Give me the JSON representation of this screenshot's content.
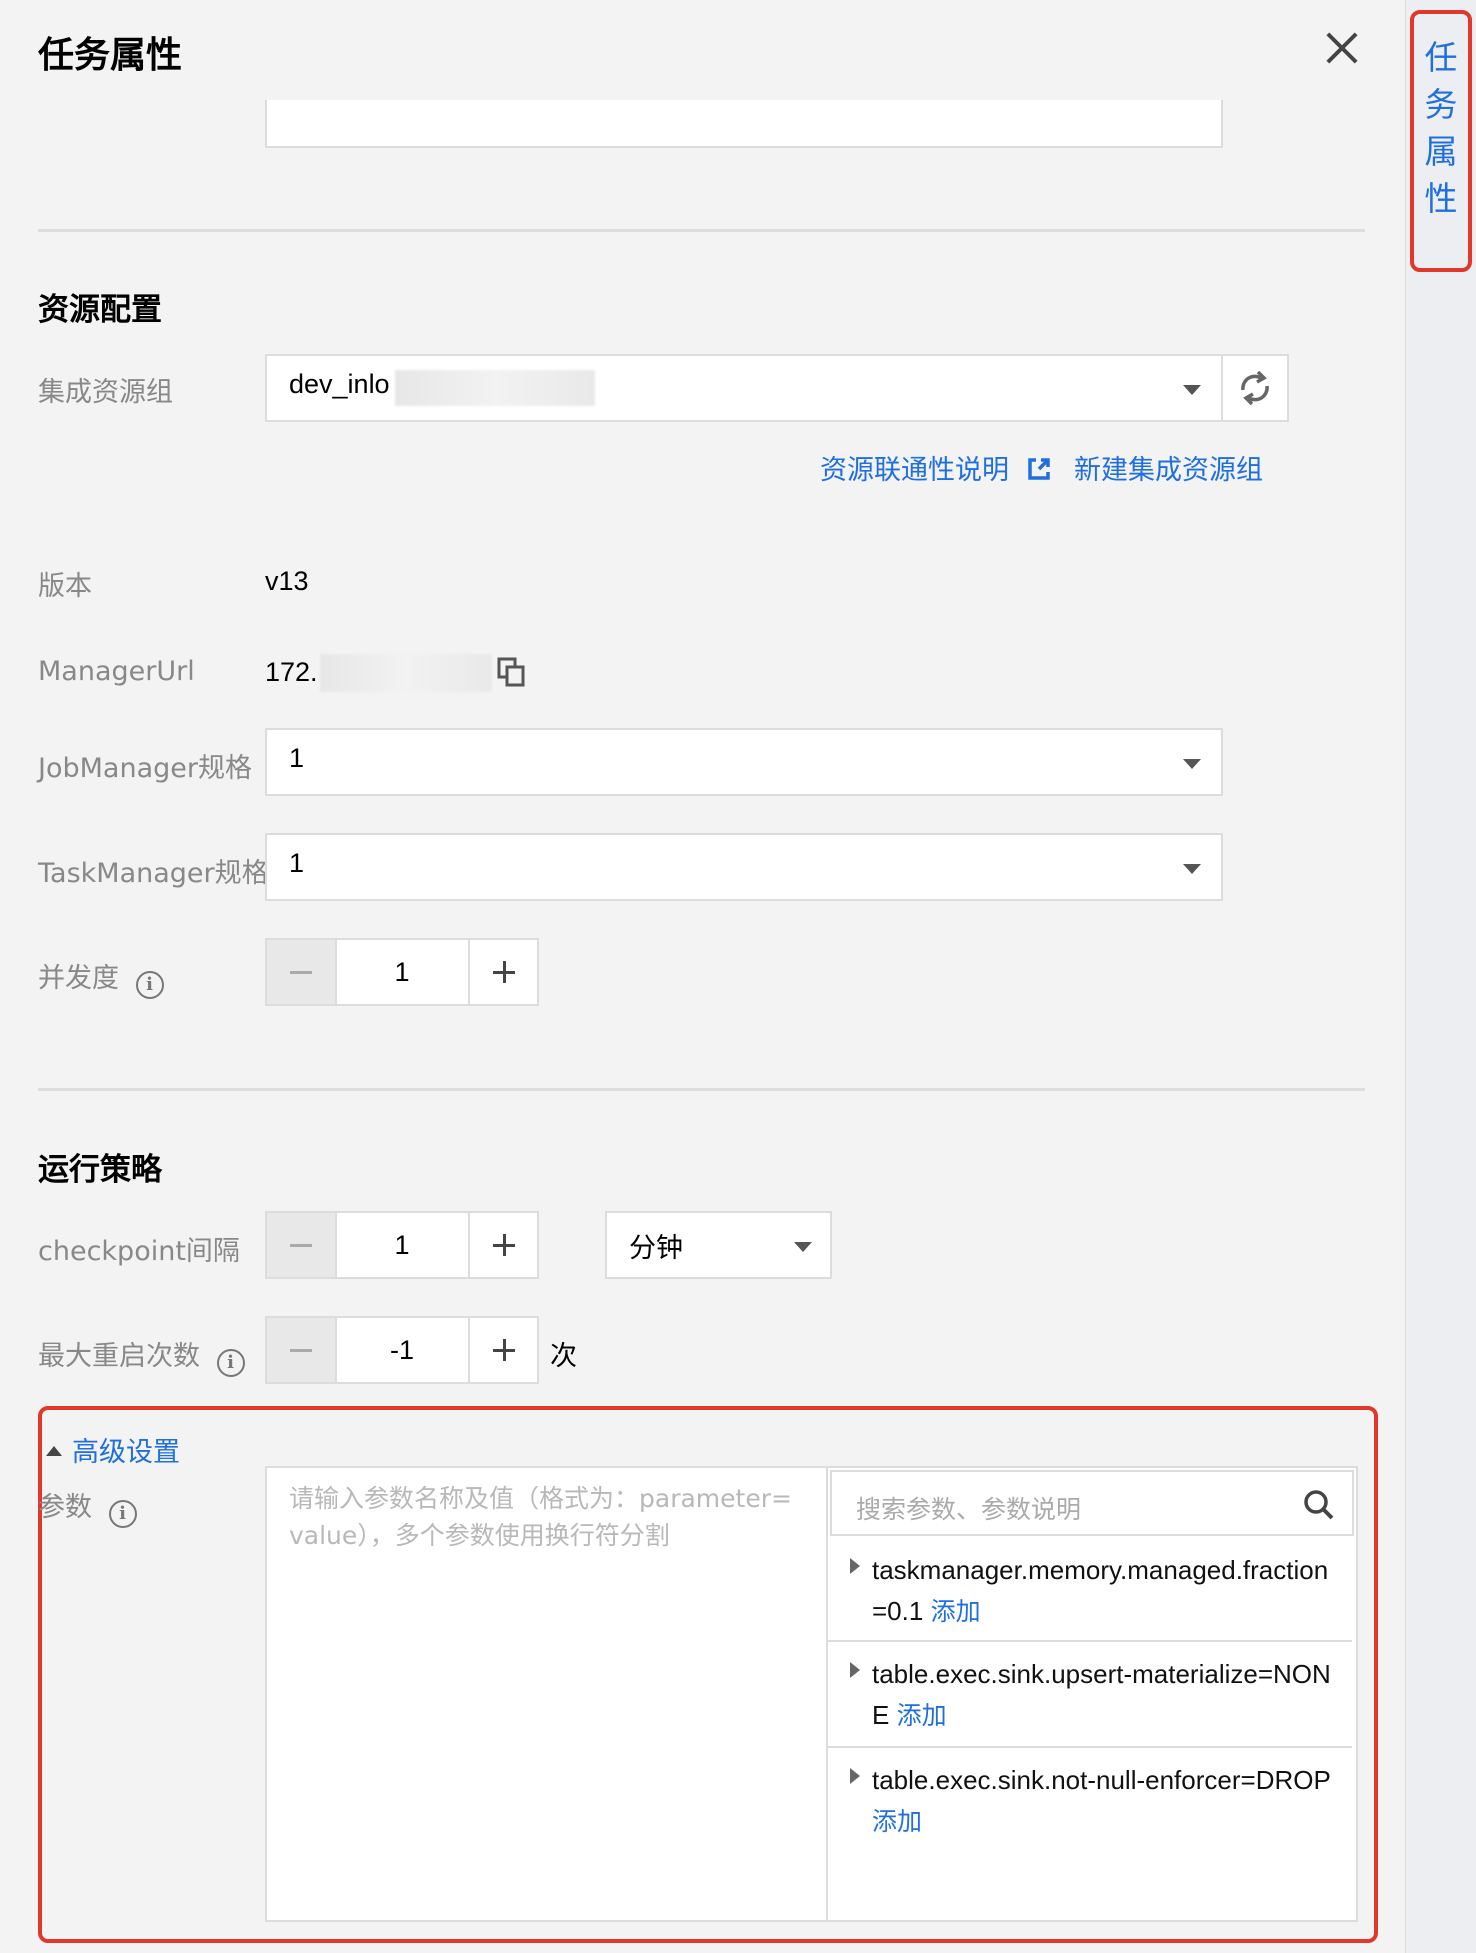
{
  "panel": {
    "title": "任务属性",
    "side_tab": [
      "任",
      "务",
      "属",
      "性"
    ]
  },
  "resource": {
    "section_title": "资源配置",
    "group_label": "集成资源组",
    "group_value": "dev_inlo",
    "link_connectivity": "资源联通性说明",
    "link_new_group": "新建集成资源组",
    "version_label": "版本",
    "version_value": "v13",
    "manager_url_label": "ManagerUrl",
    "manager_url_value": "172.",
    "jobmanager_label": "JobManager规格",
    "jobmanager_value": "1",
    "taskmanager_label": "TaskManager规格",
    "taskmanager_value": "1",
    "parallelism_label": "并发度",
    "parallelism_value": "1"
  },
  "strategy": {
    "section_title": "运行策略",
    "checkpoint_label": "checkpoint间隔",
    "checkpoint_value": "1",
    "checkpoint_unit": "分钟",
    "max_restart_label": "最大重启次数",
    "max_restart_value": "-1",
    "max_restart_suffix": "次"
  },
  "advanced": {
    "toggle_label": "高级设置",
    "params_label": "参数",
    "params_placeholder": "请输入参数名称及值（格式为：parameter=value），多个参数使用换行符分割",
    "search_placeholder": "搜索参数、参数说明",
    "add_label": "添加",
    "params": [
      {
        "text": "taskmanager.memory.managed.fraction=0.1"
      },
      {
        "text": "table.exec.sink.upsert-materialize=NONE"
      },
      {
        "text": "table.exec.sink.not-null-enforcer=DROP"
      }
    ]
  }
}
